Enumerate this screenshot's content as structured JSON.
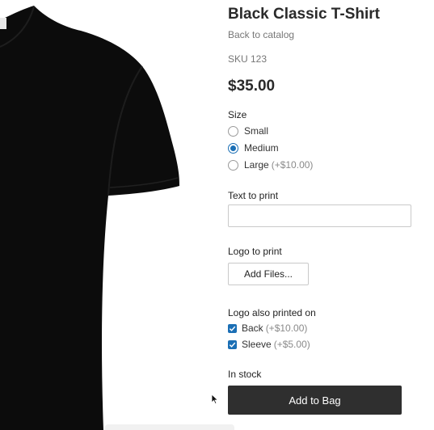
{
  "product": {
    "title": "Black Classic T-Shirt",
    "back_link": "Back to catalog",
    "sku": "SKU 123",
    "price": "$35.00",
    "image_icon": "black-tshirt-image"
  },
  "size": {
    "label": "Size",
    "options": [
      {
        "label": "Small",
        "extra": "",
        "checked": false
      },
      {
        "label": "Medium",
        "extra": "",
        "checked": true
      },
      {
        "label": "Large",
        "extra": "(+$10.00)",
        "checked": false
      }
    ]
  },
  "text_to_print": {
    "label": "Text to print",
    "value": "",
    "placeholder": ""
  },
  "logo": {
    "label": "Logo to print",
    "button": "Add Files..."
  },
  "logo_also": {
    "label": "Logo also printed on",
    "options": [
      {
        "label": "Back",
        "extra": "(+$10.00)",
        "checked": true
      },
      {
        "label": "Sleeve",
        "extra": "(+$5.00)",
        "checked": true
      }
    ]
  },
  "stock": "In stock",
  "add_to_bag": "Add to Bag",
  "colors": {
    "accent": "#1b6fb5",
    "button_bg": "#2f2f2f",
    "shirt": "#0c0c0c"
  }
}
